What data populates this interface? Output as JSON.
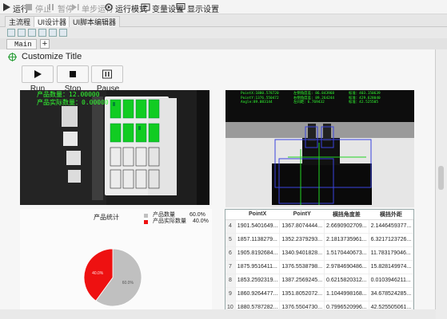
{
  "toolbar": {
    "items": [
      {
        "label": "运行",
        "state": "enabled"
      },
      {
        "label": "停止",
        "state": "disabled"
      },
      {
        "label": "暂停",
        "state": "disabled"
      },
      {
        "label": "单步运行",
        "state": "disabled"
      },
      {
        "label": "运行模式",
        "state": "enabled"
      },
      {
        "label": "变量设置",
        "state": "enabled"
      },
      {
        "label": "显示设置",
        "state": "enabled"
      }
    ]
  },
  "tabs": [
    {
      "label": "主流程",
      "active": false
    },
    {
      "label": "UI设计器",
      "active": true
    },
    {
      "label": "UI脚本编辑器",
      "active": false
    }
  ],
  "subtab": {
    "label": "Main"
  },
  "panel": {
    "title": "Customize Title",
    "controls": [
      {
        "label": "Run"
      },
      {
        "label": "Stop"
      },
      {
        "label": "Pause"
      }
    ]
  },
  "left_camera": {
    "overlay": [
      "产品数量：12.00000",
      "产品实际数量：0.00000"
    ]
  },
  "right_camera": {
    "overlay_col1": [
      "PointX:1880.578720",
      "PointY:1376.550472",
      "Angle:89.083144"
    ],
    "overlay_col2": [
      "左侧角度差: 86.843968",
      "右侧角度差: 89.264244",
      "左间距：6.769432"
    ],
    "overlay_col3": [
      "标准：403.150639",
      "标准：429.628040",
      "标准：42.525505"
    ]
  },
  "chart_data": {
    "type": "pie",
    "title": "产品统计",
    "categories": [
      "产品数量",
      "产品实际数量"
    ],
    "values": [
      60.0,
      40.0
    ],
    "value_labels": [
      "60.0%",
      "40.0%"
    ],
    "colors": [
      "#c0c0c0",
      "#ee1111"
    ],
    "legend_position": "top-right"
  },
  "table": {
    "columns": [
      "",
      "PointX",
      "PointY",
      "横挡角度差",
      "横挡外距"
    ],
    "rows": [
      [
        "4",
        "1901.5401649...",
        "1367.8074444...",
        "2.6690902709...",
        "2.1446459377..."
      ],
      [
        "5",
        "1857.1138279...",
        "1352.2379293...",
        "2.1813735961...",
        "6.3217123726..."
      ],
      [
        "6",
        "1905.8192684...",
        "1340.9401828...",
        "1.5170440673...",
        "11.783179046..."
      ],
      [
        "7",
        "1875.9516411...",
        "1376.5538798...",
        "2.9784690486...",
        "15.828149974..."
      ],
      [
        "8",
        "1853.2592319...",
        "1387.2569245...",
        "0.6215820312...",
        "0.0103946211..."
      ],
      [
        "9",
        "1860.9264477...",
        "1351.8052072...",
        "1.1044998168...",
        "34.678524285..."
      ],
      [
        "10",
        "1880.5787282...",
        "1376.5504730...",
        "0.7996520996...",
        "42.525505061..."
      ]
    ]
  }
}
